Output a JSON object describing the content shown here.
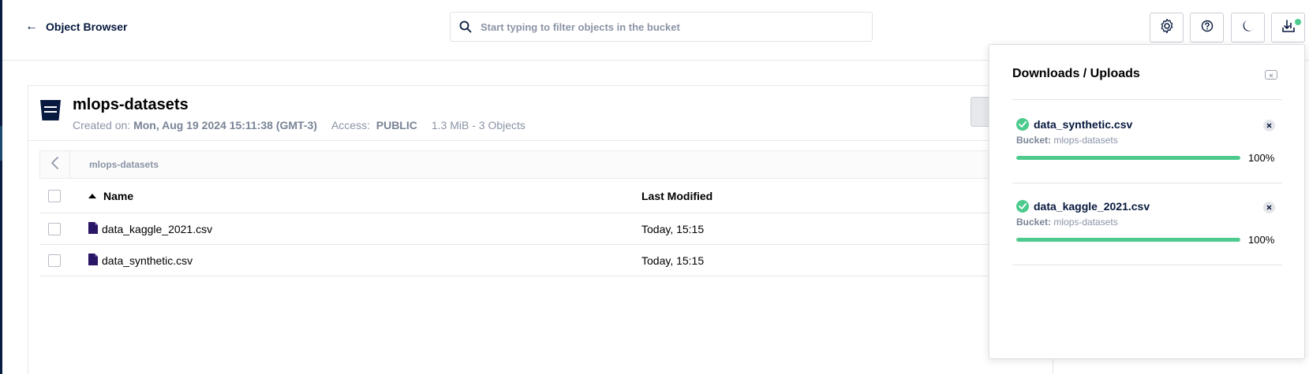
{
  "header": {
    "back_label": "Object Browser",
    "search_placeholder": "Start typing to filter objects in the bucket",
    "tools": [
      {
        "name": "settings",
        "icon": "gear-icon"
      },
      {
        "name": "help",
        "icon": "help-circle-icon"
      },
      {
        "name": "theme",
        "icon": "moon-icon"
      },
      {
        "name": "downloads",
        "icon": "download-tray-icon"
      }
    ]
  },
  "bucket": {
    "name": "mlops-datasets",
    "created_label": "Created on:",
    "created_value": "Mon, Aug 19 2024 15:11:38 (GMT-3)",
    "access_label": "Access:",
    "access_value": "PUBLIC",
    "summary": "1.3 MiB - 3 Objects"
  },
  "breadcrumb": {
    "path": "mlops-datasets"
  },
  "table": {
    "columns": {
      "name": "Name",
      "last_modified": "Last Modified"
    },
    "rows": [
      {
        "name": "data_kaggle_2021.csv",
        "last_modified": "Today, 15:15"
      },
      {
        "name": "data_synthetic.csv",
        "last_modified": "Today, 15:15"
      }
    ]
  },
  "transfers": {
    "title": "Downloads / Uploads",
    "items": [
      {
        "file": "data_synthetic.csv",
        "bucket_label": "Bucket:",
        "bucket": "mlops-datasets",
        "progress": 100,
        "progress_text": "100%"
      },
      {
        "file": "data_kaggle_2021.csv",
        "bucket_label": "Bucket:",
        "bucket": "mlops-datasets",
        "progress": 100,
        "progress_text": "100%"
      }
    ]
  },
  "colors": {
    "brand": "#07193e",
    "success": "#4ccb8d"
  }
}
